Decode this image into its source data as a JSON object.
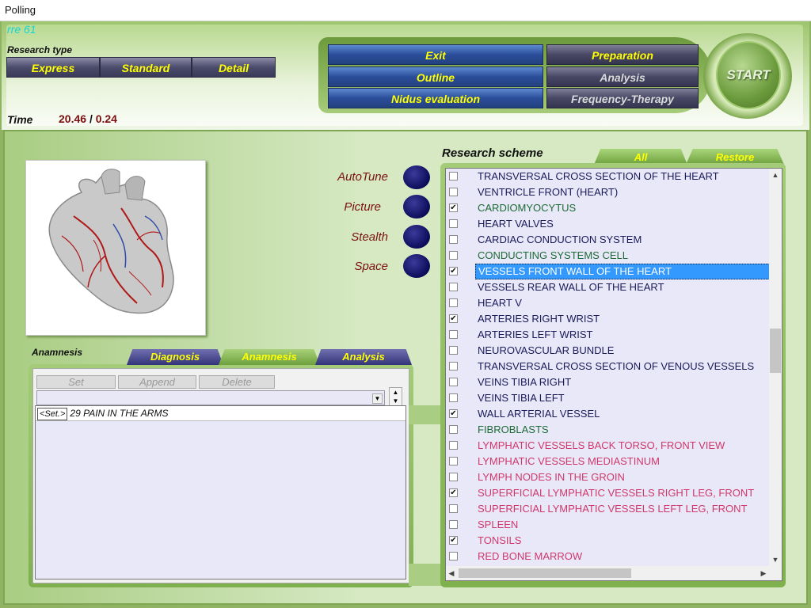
{
  "window": {
    "title": "Polling"
  },
  "header": {
    "code": "rre 61",
    "research_type_label": "Research type",
    "research_types": [
      "Express",
      "Standard",
      "Detail"
    ],
    "time_label": "Time",
    "time_value": "20.46",
    "time_separator": "/",
    "time_total": "0.24"
  },
  "control_panel": {
    "exit": "Exit",
    "outline": "Outline",
    "nidus": "Nidus evaluation",
    "preparation": "Preparation",
    "analysis": "Analysis",
    "frequency": "Frequency-Therapy",
    "start": "START"
  },
  "options": {
    "autotune": "AutoTune",
    "picture": "Picture",
    "stealth": "Stealth",
    "space": "Space"
  },
  "anamnesis": {
    "label": "Anamnesis",
    "tabs": [
      "Diagnosis",
      "Anamnesis",
      "Analysis"
    ],
    "buttons": {
      "set": "Set",
      "append": "Append",
      "delete": "Delete"
    },
    "entries": [
      {
        "tag": "<Set.>",
        "text": "29 PAIN IN THE ARMS"
      }
    ]
  },
  "research_scheme": {
    "label": "Research scheme",
    "tabs": [
      "All",
      "Restore"
    ],
    "colors": {
      "blue": "#1a1a5a",
      "green": "#1d6b35",
      "pink": "#d0386a"
    },
    "items": [
      {
        "text": "TRANSVERSAL CROSS SECTION OF THE HEART",
        "checked": false,
        "color": "blue"
      },
      {
        "text": "VENTRICLE FRONT (HEART)",
        "checked": false,
        "color": "blue"
      },
      {
        "text": "CARDIOMYOCYTUS",
        "checked": true,
        "color": "green"
      },
      {
        "text": "HEART VALVES",
        "checked": false,
        "color": "blue"
      },
      {
        "text": "CARDIAC CONDUCTION SYSTEM",
        "checked": false,
        "color": "blue"
      },
      {
        "text": "CONDUCTING SYSTEMS CELL",
        "checked": false,
        "color": "green"
      },
      {
        "text": "VESSELS FRONT WALL OF THE HEART",
        "checked": true,
        "color": "blue",
        "selected": true
      },
      {
        "text": "VESSELS REAR WALL OF THE HEART",
        "checked": false,
        "color": "blue"
      },
      {
        "text": "HEART  V",
        "checked": false,
        "color": "blue"
      },
      {
        "text": "ARTERIES RIGHT WRIST",
        "checked": true,
        "color": "blue"
      },
      {
        "text": "ARTERIES LEFT WRIST",
        "checked": false,
        "color": "blue"
      },
      {
        "text": "NEUROVASCULAR BUNDLE",
        "checked": false,
        "color": "blue"
      },
      {
        "text": "TRANSVERSAL CROSS SECTION OF VENOUS VESSELS",
        "checked": false,
        "color": "blue"
      },
      {
        "text": "VEINS TIBIA RIGHT",
        "checked": false,
        "color": "blue"
      },
      {
        "text": "VEINS TIBIA LEFT",
        "checked": false,
        "color": "blue"
      },
      {
        "text": "WALL ARTERIAL VESSEL",
        "checked": true,
        "color": "blue"
      },
      {
        "text": "FIBROBLASTS",
        "checked": false,
        "color": "green"
      },
      {
        "text": "LYMPHATIC VESSELS BACK TORSO, FRONT VIEW",
        "checked": false,
        "color": "pink"
      },
      {
        "text": "LYMPHATIC VESSELS MEDIASTINUM",
        "checked": false,
        "color": "pink"
      },
      {
        "text": "LYMPH NODES IN THE GROIN",
        "checked": false,
        "color": "pink"
      },
      {
        "text": "SUPERFICIAL LYMPHATIC VESSELS RIGHT LEG, FRONT",
        "checked": true,
        "color": "pink"
      },
      {
        "text": "SUPERFICIAL LYMPHATIC VESSELS LEFT LEG, FRONT",
        "checked": false,
        "color": "pink"
      },
      {
        "text": "SPLEEN",
        "checked": false,
        "color": "pink"
      },
      {
        "text": "TONSILS",
        "checked": true,
        "color": "pink"
      },
      {
        "text": "RED BONE MARROW",
        "checked": false,
        "color": "pink"
      }
    ]
  },
  "icons": {
    "heart_image": "heart-anatomy-icon",
    "check": "✔",
    "arrow_up": "▲",
    "arrow_down": "▼",
    "arrow_left": "◀",
    "arrow_right": "▶"
  }
}
